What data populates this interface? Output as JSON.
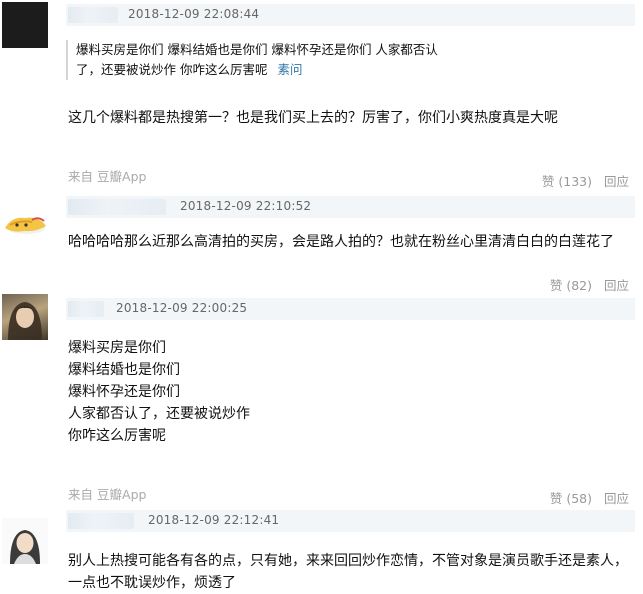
{
  "comments": [
    {
      "time": "2018-12-09 22:08:44",
      "quote": {
        "line1": "爆料买房是你们 爆料结婚也是你们 爆料怀孕还是你们 人家都否认",
        "line2": "了，还要被说炒作 你咋这么厉害呢",
        "user": "素问"
      },
      "text": "这几个爆料都是热搜第一？也是我们买上去的？厉害了，你们小爽热度真是大呢",
      "source_label": "来自",
      "source_app": "豆瓣App",
      "likes": "赞 (133)",
      "reply": "回应"
    },
    {
      "time": "2018-12-09 22:10:52",
      "text": "哈哈哈哈那么近那么高清拍的买房，会是路人拍的？也就在粉丝心里清清白白的白莲花了",
      "likes": "赞 (82)",
      "reply": "回应"
    },
    {
      "time": "2018-12-09 22:00:25",
      "lines": [
        "爆料买房是你们",
        "爆料结婚也是你们",
        "爆料怀孕还是你们",
        "人家都否认了，还要被说炒作",
        "你咋这么厉害呢"
      ],
      "source_label": "来自",
      "source_app": "豆瓣App",
      "likes": "赞 (58)",
      "reply": "回应"
    },
    {
      "time": "2018-12-09 22:12:41",
      "lines": [
        "别人上热搜可能各有各的点，只有她，来来回回炒作恋情，不管对象是演员歌手还是素人，",
        "一点也不耽误炒作，烦透了"
      ]
    }
  ]
}
